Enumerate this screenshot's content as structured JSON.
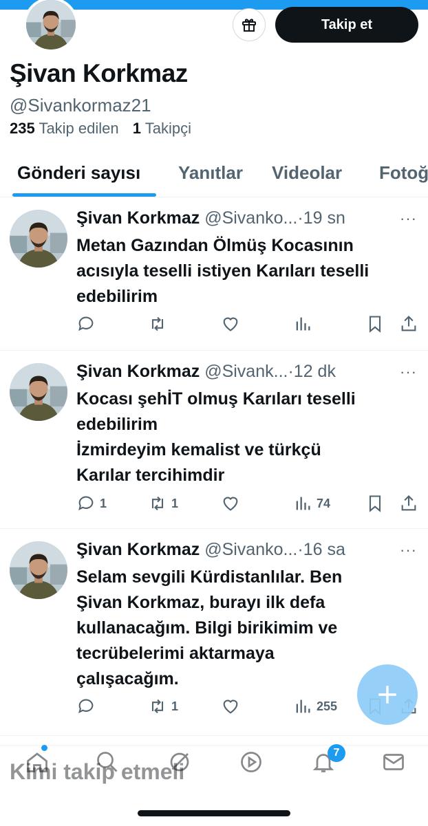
{
  "header": {
    "follow_label": "Takip et"
  },
  "profile": {
    "name": "Şivan Korkmaz",
    "handle": "@Sivankormaz21",
    "following_count": "235",
    "following_label": "Takip edilen",
    "followers_count": "1",
    "followers_label": "Takipçi"
  },
  "tabs": [
    {
      "label": "Gönderi sayısı",
      "active": true
    },
    {
      "label": "Yanıtlar"
    },
    {
      "label": "Videolar"
    },
    {
      "label": "Fotoğ"
    }
  ],
  "tweets": [
    {
      "name": "Şivan Korkmaz",
      "handle": "@Sivanko...",
      "time": "19 sn",
      "lines": [
        "Metan Gazından Ölmüş  Kocasının",
        "acısıyla teselli istiyen Karıları teselli",
        "edebilirim"
      ],
      "replies": "",
      "reposts": "",
      "views": ""
    },
    {
      "name": "Şivan Korkmaz",
      "handle": "@Sivank...",
      "time": "12 dk",
      "lines": [
        "Kocası şehİT olmuş Karıları teselli",
        "edebilirim",
        "İzmirdeyim kemalist ve türkçü",
        "Karılar tercihimdir"
      ],
      "replies": "1",
      "reposts": "1",
      "views": "74"
    },
    {
      "name": "Şivan Korkmaz",
      "handle": "@Sivanko...",
      "time": "16 sa",
      "lines": [
        "Selam sevgili Kürdistanlılar. Ben",
        "Şivan Korkmaz, burayı ilk defa",
        "kullanacağım. Bilgi birikimim ve",
        "tecrübelerimi aktarmaya",
        "çalışacağım."
      ],
      "replies": "",
      "reposts": "1",
      "views": "255"
    }
  ],
  "separator": "·",
  "more_glyph": "···",
  "who_to_follow": "Kimi takip etmeli",
  "nav": {
    "notifications_badge": "7"
  },
  "colors": {
    "accent": "#1d9bf0",
    "text": "#0f1419",
    "muted": "#536471",
    "fab": "#8ecdf8"
  }
}
